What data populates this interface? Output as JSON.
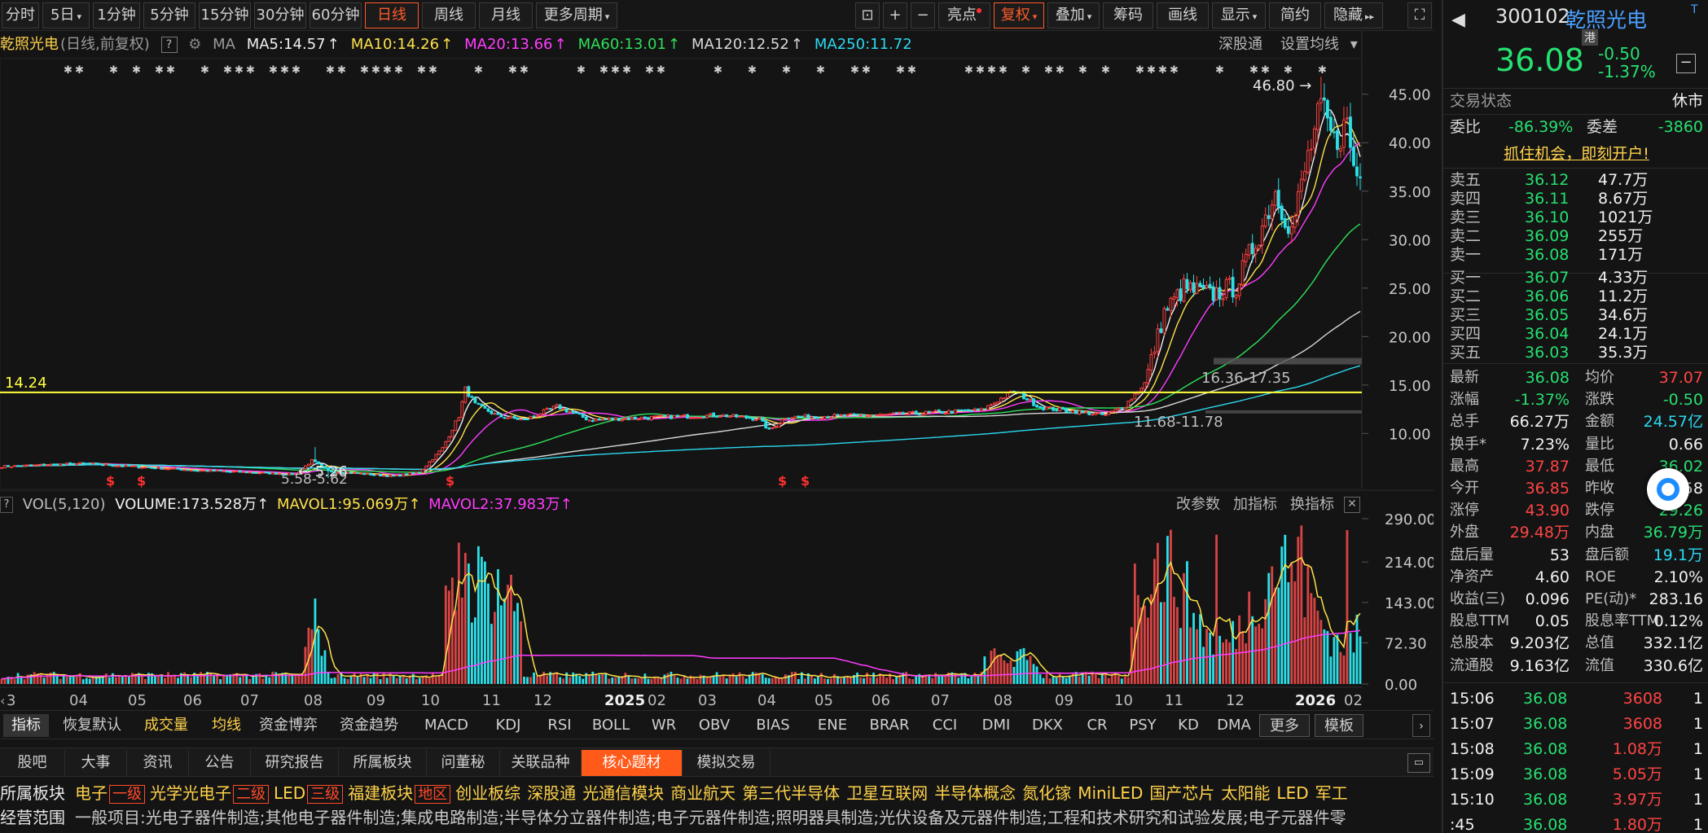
{
  "period_tabs": [
    "分时",
    "5日",
    "1分钟",
    "5分钟",
    "15分钟",
    "30分钟",
    "60分钟",
    "日线",
    "周线",
    "月线",
    "更多周期"
  ],
  "period_active": "日线",
  "toolbar": [
    "亮点",
    "复权",
    "叠加",
    "筹码",
    "画线",
    "显示",
    "简约",
    "隐藏"
  ],
  "toolbar_active": "复权",
  "stock": {
    "code": "300102",
    "name": "乾照光电",
    "badge": "港",
    "price": "36.08",
    "change": "-0.50",
    "pct": "-1.37%"
  },
  "ma_bar": {
    "title": "乾照光电",
    "mode": "(日线,前复权)",
    "ma_label": "MA",
    "items": [
      {
        "label": "MA5:14.57",
        "color": "#f0f0f0"
      },
      {
        "label": "MA10:14.26",
        "color": "#ffe14a"
      },
      {
        "label": "MA20:13.66",
        "color": "#ff3cff"
      },
      {
        "label": "MA60:13.01",
        "color": "#2ee05a"
      },
      {
        "label": "MA120:12.52",
        "color": "#d8d8d8"
      },
      {
        "label": "MA250:11.72",
        "color": "#2bd8f0"
      }
    ],
    "right1": "深股通",
    "right2": "设置均线"
  },
  "main_chart": {
    "y_ticks": [
      "45.00",
      "40.00",
      "35.00",
      "30.00",
      "25.00",
      "20.00",
      "15.00",
      "10.00"
    ],
    "y_values": [
      45,
      40,
      35,
      30,
      25,
      20,
      15,
      10
    ],
    "y_top": 48,
    "y_bottom": 6,
    "hline_label": "14.24",
    "hline_value": 14.24,
    "annotations": {
      "high": "46.80",
      "low": "5.26",
      "low_range": "5.58-5.62",
      "range1": "16.36-17.35",
      "range2": "11.68-11.78"
    }
  },
  "vol_bar": {
    "label": "VOL(5,120)",
    "volume": "VOLUME:173.528万",
    "mavol1": "MAVOL1:95.069万",
    "mavol2": "MAVOL2:37.983万",
    "btns": [
      "改参数",
      "加指标",
      "换指标"
    ]
  },
  "vol_chart": {
    "y_ticks": [
      "290.00",
      "214.00",
      "143.00",
      "72.30",
      "0.00"
    ],
    "y_values": [
      290,
      214,
      143,
      72.3,
      0
    ],
    "y_max": 300
  },
  "x_axis": [
    "3",
    "04",
    "05",
    "06",
    "07",
    "08",
    "09",
    "10",
    "11",
    "12",
    "2025",
    "02",
    "03",
    "04",
    "05",
    "06",
    "07",
    "08",
    "09",
    "10",
    "11",
    "12",
    "2026",
    "02"
  ],
  "indicator_bar": [
    "指标",
    "恢复默认",
    "成交量",
    "均线",
    "资金博弈",
    "资金趋势",
    "MACD",
    "KDJ",
    "RSI",
    "BOLL",
    "WR",
    "OBV",
    "BIAS",
    "ENE",
    "BRAR",
    "CCI",
    "DMI",
    "DKX",
    "CR",
    "PSY",
    "KD",
    "DMA",
    "更多",
    "模板"
  ],
  "bottom_tabs": [
    "股吧",
    "大事",
    "资讯",
    "公告",
    "研究报告",
    "所属板块",
    "问董秘",
    "关联品种",
    "核心题材",
    "模拟交易"
  ],
  "bottom_active": "核心题材",
  "sector_line": {
    "label": "所属板块",
    "items": [
      {
        "t": "电子",
        "tag": "一级"
      },
      {
        "t": "光学光电子",
        "tag": "二级"
      },
      {
        "t": "LED",
        "tag": "三级"
      },
      {
        "t": "福建板块",
        "tag": "地区"
      },
      {
        "t": "创业板综"
      },
      {
        "t": "深股通"
      },
      {
        "t": "光通信模块"
      },
      {
        "t": "商业航天"
      },
      {
        "t": "第三代半导体"
      },
      {
        "t": "卫星互联网"
      },
      {
        "t": "半导体概念"
      },
      {
        "t": "氮化镓"
      },
      {
        "t": "MiniLED"
      },
      {
        "t": "国产芯片"
      },
      {
        "t": "太阳能"
      },
      {
        "t": "LED"
      },
      {
        "t": "军工"
      }
    ]
  },
  "business_line": {
    "label": "经营范围",
    "text": "一般项目:光电子器件制造;其他电子器件制造;集成电路制造;半导体分立器件制造;电子元器件制造;照明器具制造;光伏设备及元器件制造;工程和技术研究和试验发展;电子元器件零"
  },
  "trade_status": {
    "label": "交易状态",
    "value": "休市"
  },
  "weibi": {
    "label": "委比",
    "value": "-86.39%",
    "label2": "委差",
    "value2": "-3860"
  },
  "open_account": "抓住机会，即刻开户!",
  "asks": [
    {
      "l": "卖五",
      "p": "36.12",
      "v": "47.7万"
    },
    {
      "l": "卖四",
      "p": "36.11",
      "v": "8.67万"
    },
    {
      "l": "卖三",
      "p": "36.10",
      "v": "1021万"
    },
    {
      "l": "卖二",
      "p": "36.09",
      "v": "255万"
    },
    {
      "l": "卖一",
      "p": "36.08",
      "v": "171万"
    }
  ],
  "bids": [
    {
      "l": "买一",
      "p": "36.07",
      "v": "4.33万"
    },
    {
      "l": "买二",
      "p": "36.06",
      "v": "11.2万"
    },
    {
      "l": "买三",
      "p": "36.05",
      "v": "34.6万"
    },
    {
      "l": "买四",
      "p": "36.04",
      "v": "24.1万"
    },
    {
      "l": "买五",
      "p": "36.03",
      "v": "35.3万"
    }
  ],
  "stats": [
    {
      "l1": "最新",
      "v1": "36.08",
      "c1": "grn",
      "l2": "均价",
      "v2": "37.07",
      "c2": "red"
    },
    {
      "l1": "涨幅",
      "v1": "-1.37%",
      "c1": "grn",
      "l2": "涨跌",
      "v2": "-0.50",
      "c2": "grn"
    },
    {
      "l1": "总手",
      "v1": "66.27万",
      "c1": "wht",
      "l2": "金额",
      "v2": "24.57亿",
      "c2": "cyan"
    },
    {
      "l1": "换手*",
      "v1": "7.23%",
      "c1": "wht",
      "l2": "量比",
      "v2": "0.66",
      "c2": "wht"
    },
    {
      "l1": "最高",
      "v1": "37.87",
      "c1": "red",
      "l2": "最低",
      "v2": "36.02",
      "c2": "grn"
    },
    {
      "l1": "今开",
      "v1": "36.85",
      "c1": "red",
      "l2": "昨收",
      "v2": "36.58",
      "c2": "wht"
    },
    {
      "l1": "涨停",
      "v1": "43.90",
      "c1": "red",
      "l2": "跌停",
      "v2": "29.26",
      "c2": "grn"
    },
    {
      "l1": "外盘",
      "v1": "29.48万",
      "c1": "red",
      "l2": "内盘",
      "v2": "36.79万",
      "c2": "grn"
    },
    {
      "l1": "盘后量",
      "v1": "53",
      "c1": "wht",
      "l2": "盘后额",
      "v2": "19.1万",
      "c2": "cyan"
    },
    {
      "l1": "净资产",
      "v1": "4.60",
      "c1": "wht",
      "l2": "ROE",
      "v2": "2.10%",
      "c2": "wht"
    },
    {
      "l1": "收益(三)",
      "v1": "0.096",
      "c1": "wht",
      "l2": "PE(动)*",
      "v2": "283.16",
      "c2": "wht"
    },
    {
      "l1": "股息TTM",
      "v1": "0.05",
      "c1": "wht",
      "l2": "股息率TTM",
      "v2": "0.12%",
      "c2": "wht"
    },
    {
      "l1": "总股本",
      "v1": "9.203亿",
      "c1": "wht",
      "l2": "总值",
      "v2": "332.1亿",
      "c2": "wht"
    },
    {
      "l1": "流通股",
      "v1": "9.163亿",
      "c1": "wht",
      "l2": "流值",
      "v2": "330.6亿",
      "c2": "wht"
    }
  ],
  "ticks": [
    {
      "t": "15:06",
      "p": "36.08",
      "v": "3608",
      "n": "1"
    },
    {
      "t": "15:07",
      "p": "36.08",
      "v": "3608",
      "n": "1"
    },
    {
      "t": "15:08",
      "p": "36.08",
      "v": "1.08万",
      "n": "1"
    },
    {
      "t": "15:09",
      "p": "36.08",
      "v": "5.05万",
      "n": "1"
    },
    {
      "t": "15:10",
      "p": "36.08",
      "v": "3.97万",
      "n": "1"
    },
    {
      "t": ":45",
      "p": "36.08",
      "v": "1.80万",
      "n": "1"
    }
  ],
  "colors": {
    "up": "#ff4040",
    "down": "#2be0e8",
    "ma5": "#f0f0f0",
    "ma10": "#ffe14a",
    "ma20": "#ff3cff",
    "ma60": "#2ee05a",
    "ma120": "#d8d8d8",
    "ma250": "#2bd8f0",
    "accent": "#ff5a1a"
  }
}
